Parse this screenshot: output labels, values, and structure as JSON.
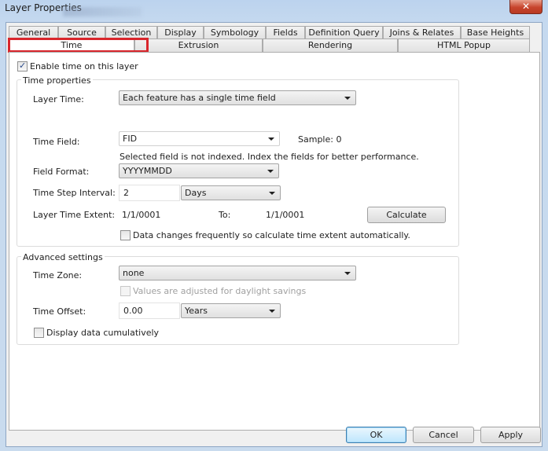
{
  "window": {
    "title": "Layer Properties",
    "close_icon": "✕"
  },
  "tabs": {
    "row1": [
      {
        "label": "General"
      },
      {
        "label": "Source"
      },
      {
        "label": "Selection"
      },
      {
        "label": "Display"
      },
      {
        "label": "Symbology"
      },
      {
        "label": "Fields"
      },
      {
        "label": "Definition Query"
      },
      {
        "label": "Joins & Relates"
      },
      {
        "label": "Base Heights"
      }
    ],
    "row2": [
      {
        "label": "Time",
        "active": true
      },
      {
        "label": "Extrusion"
      },
      {
        "label": "Rendering"
      },
      {
        "label": "HTML Popup"
      }
    ]
  },
  "highlight_color": "#d9262c",
  "enable_time": {
    "label": "Enable time on this layer",
    "checked": true
  },
  "time_properties": {
    "title": "Time properties",
    "layer_time": {
      "label": "Layer Time:",
      "value": "Each feature has a single time field"
    },
    "time_field": {
      "label": "Time Field:",
      "value": "FID",
      "sample": "Sample: 0"
    },
    "index_hint": "Selected field is not indexed. Index the fields for better performance.",
    "field_format": {
      "label": "Field Format:",
      "value": "YYYYMMDD"
    },
    "time_step": {
      "label": "Time Step Interval:",
      "value": "2",
      "unit": "Days"
    },
    "extent": {
      "label": "Layer Time Extent:",
      "from": "1/1/0001",
      "to_label": "To:",
      "to": "1/1/0001",
      "calculate": "Calculate"
    },
    "auto_calc": {
      "label": "Data changes frequently so calculate time extent automatically.",
      "checked": false
    }
  },
  "advanced": {
    "title": "Advanced settings",
    "time_zone": {
      "label": "Time Zone:",
      "value": "none"
    },
    "daylight": {
      "label": "Values are adjusted for daylight savings",
      "checked": false,
      "disabled": true
    },
    "time_offset": {
      "label": "Time Offset:",
      "value": "0.00",
      "unit": "Years"
    },
    "cumulative": {
      "label": "Display data cumulatively",
      "checked": false
    }
  },
  "footer": {
    "ok": "OK",
    "cancel": "Cancel",
    "apply": "Apply"
  }
}
